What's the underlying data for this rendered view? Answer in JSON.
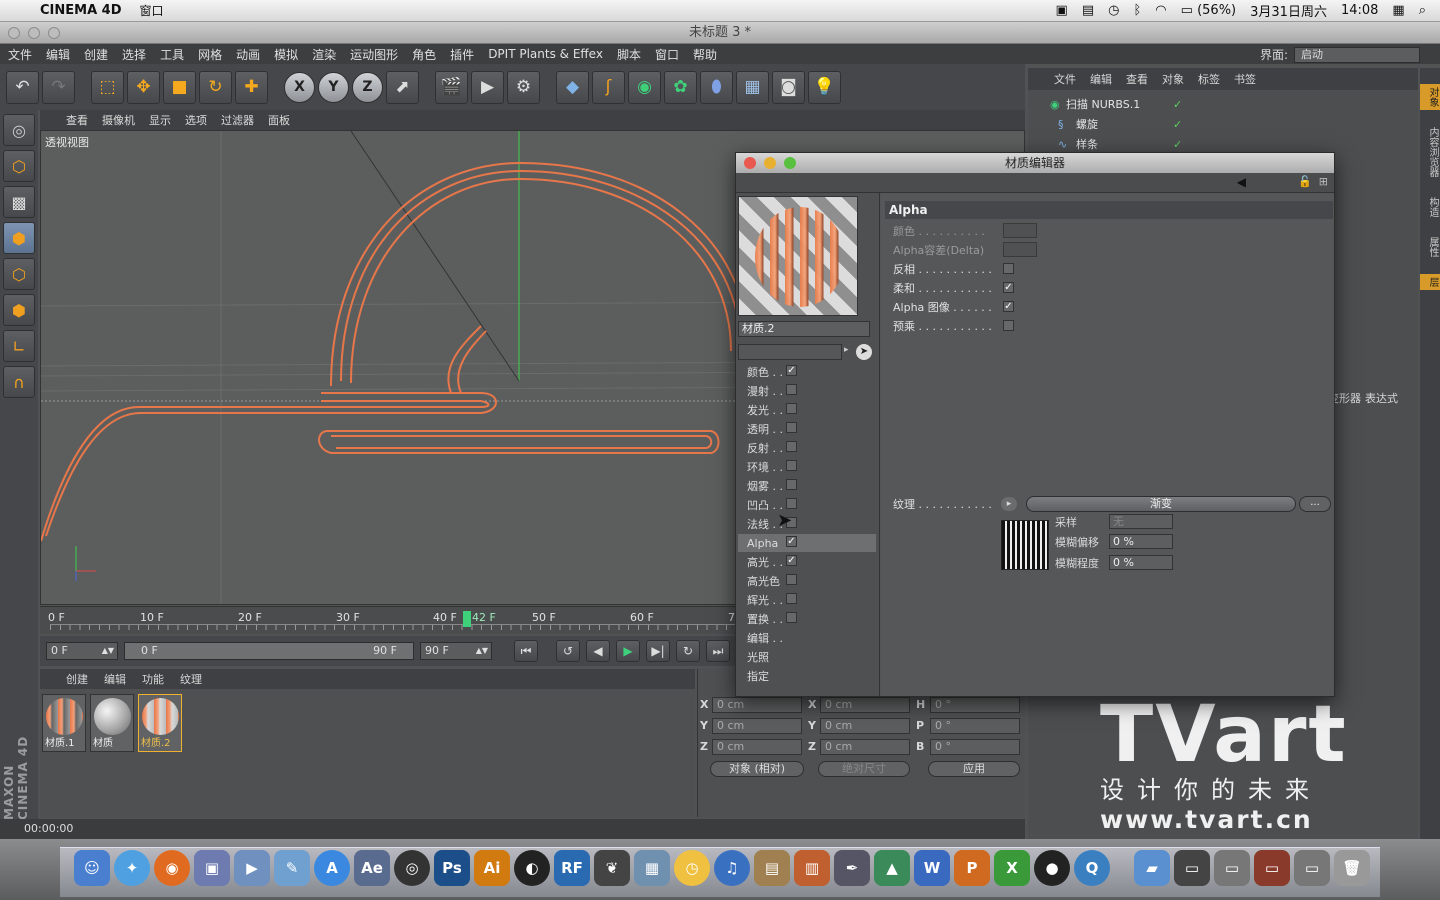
{
  "mac_menubar": {
    "app_name": "CINEMA 4D",
    "menu": "窗口",
    "battery": "(56%)",
    "date": "3月31日周六",
    "time": "14:08"
  },
  "window": {
    "title": "未标题 3 *"
  },
  "app_menu": {
    "items": [
      "文件",
      "编辑",
      "创建",
      "选择",
      "工具",
      "网格",
      "动画",
      "模拟",
      "渲染",
      "运动图形",
      "角色",
      "插件",
      "DPIT Plants & Effex",
      "脚本",
      "窗口",
      "帮助"
    ],
    "layout_label": "界面:",
    "layout_value": "启动"
  },
  "viewport": {
    "menu": [
      "查看",
      "摄像机",
      "显示",
      "选项",
      "过滤器",
      "面板"
    ],
    "label": "透视视图"
  },
  "timeline": {
    "ticks": [
      "0 F",
      "10 F",
      "20 F",
      "30 F",
      "40 F",
      "50 F",
      "60 F",
      "7"
    ],
    "current_frame": "42 F",
    "start_field": "0 F",
    "slider_start": "0 F",
    "slider_end": "90 F",
    "end_field": "90 F"
  },
  "materials": {
    "menu": [
      "创建",
      "编辑",
      "功能",
      "纹理"
    ],
    "items": [
      {
        "name": "材质.1"
      },
      {
        "name": "材质"
      },
      {
        "name": "材质.2"
      }
    ]
  },
  "coords": {
    "rows": [
      {
        "a": "X",
        "av": "0 cm",
        "b": "X",
        "bv": "0 cm",
        "c": "H",
        "cv": "0 °"
      },
      {
        "a": "Y",
        "av": "0 cm",
        "b": "Y",
        "bv": "0 cm",
        "c": "P",
        "cv": "0 °"
      },
      {
        "a": "Z",
        "av": "0 cm",
        "b": "Z",
        "bv": "0 cm",
        "c": "B",
        "cv": "0 °"
      }
    ],
    "mode": "对象 (相对)",
    "size_mode": "绝对尺寸",
    "apply": "应用"
  },
  "status": {
    "time": "00:00:00"
  },
  "object_manager": {
    "menu": [
      "文件",
      "编辑",
      "查看",
      "对象",
      "标签",
      "书签"
    ],
    "objects": [
      {
        "name": "扫描 NURBS.1"
      },
      {
        "name": "螺旋"
      },
      {
        "name": "样条"
      }
    ],
    "attr_tabs": [
      "变形器",
      "表达式"
    ]
  },
  "right_strip": [
    "对象",
    "内容浏览器",
    "构造",
    "属性",
    "层"
  ],
  "material_editor": {
    "title": "材质编辑器",
    "material_name": "材质.2",
    "channels": [
      {
        "label": "颜色 . .",
        "checked": true
      },
      {
        "label": "漫射 . .",
        "checked": false
      },
      {
        "label": "发光 . .",
        "checked": false
      },
      {
        "label": "透明 . .",
        "checked": false
      },
      {
        "label": "反射 . .",
        "checked": false
      },
      {
        "label": "环境 . .",
        "checked": false
      },
      {
        "label": "烟雾 . .",
        "checked": false
      },
      {
        "label": "凹凸 . .",
        "checked": false
      },
      {
        "label": "法线 . .",
        "checked": false
      },
      {
        "label": "Alpha",
        "checked": true
      },
      {
        "label": "高光 . .",
        "checked": true
      },
      {
        "label": "高光色",
        "checked": false
      },
      {
        "label": "辉光 . .",
        "checked": false
      },
      {
        "label": "置换 . .",
        "checked": false
      }
    ],
    "extra": [
      "编辑 . .",
      "光照",
      "指定"
    ],
    "section": "Alpha",
    "props": [
      {
        "label": "颜色 . . . . . . . . . .",
        "dim": true,
        "swatch": true
      },
      {
        "label": "Alpha容差(Delta)",
        "dim": true,
        "swatch": true
      },
      {
        "label": "反相 . . . . . . . . . . .",
        "checked": false
      },
      {
        "label": "柔和 . . . . . . . . . . .",
        "checked": true
      },
      {
        "label": "Alpha 图像 . . . . . .",
        "checked": true
      },
      {
        "label": "预乘 . . . . . . . . . . .",
        "checked": false
      }
    ],
    "texture_label": "纹理 . . . . . . . . . . .",
    "texture_button": "渐变",
    "dots": "...",
    "sampling_label": "采样",
    "sampling_value": "无",
    "blur_offset_label": "模糊偏移",
    "blur_offset_value": "0 %",
    "blur_scale_label": "模糊程度",
    "blur_scale_value": "0 %"
  },
  "brand": {
    "logo": "TVart",
    "tagline": "设计你的未来",
    "url": "www.tvart.cn"
  },
  "colors": {
    "accent": "#f0a020",
    "playhead": "#3fd07a",
    "spline": "#e7774a"
  }
}
